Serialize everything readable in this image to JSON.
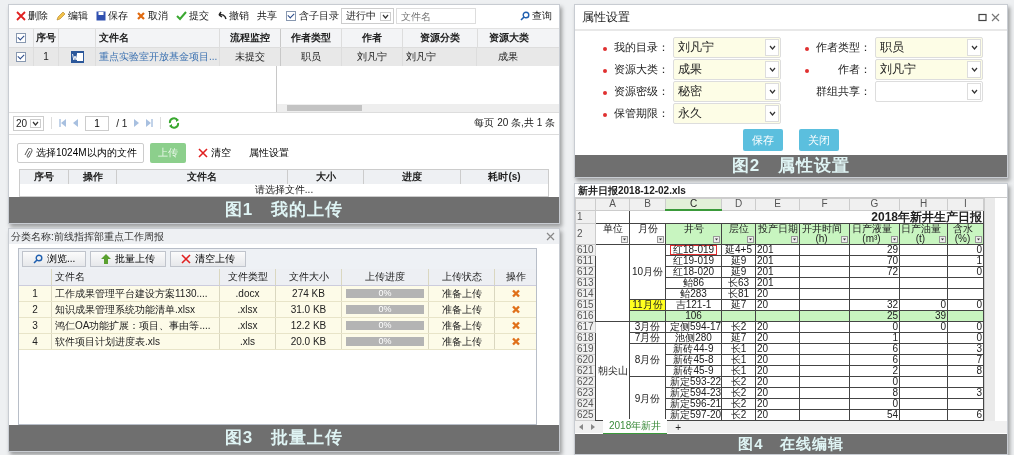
{
  "upload_panel": {
    "toolbar": [
      {
        "kind": "delete",
        "label": "删除"
      },
      {
        "kind": "edit",
        "label": "编辑"
      },
      {
        "kind": "save",
        "label": "保存"
      },
      {
        "kind": "cancel",
        "label": "取消"
      },
      {
        "kind": "submit",
        "label": "提交"
      },
      {
        "kind": "undo",
        "label": "撤销"
      },
      {
        "kind": "text",
        "label": "共享"
      }
    ],
    "subdir": {
      "label": "含子目录",
      "checked": true
    },
    "status_select": "进行中",
    "search": {
      "placeholder": "文件名",
      "button": "查询"
    },
    "columns": [
      "序号",
      "文件名",
      "流程监控",
      "作者类型",
      "作者",
      "资源分类",
      "资源大类"
    ],
    "all_checked": true,
    "rows": [
      {
        "checked": true,
        "number": "1",
        "name": "重点实验室开放基金项目...",
        "flow": "未提交",
        "author_type": "职员",
        "author": "刘凡宁",
        "category": "刘凡宁",
        "major": "成果"
      }
    ],
    "pager": {
      "page_size": "20",
      "page": "1",
      "total_pages": "/ 1",
      "summary": "每页 20 条,共 1 条"
    },
    "upload_actions": {
      "choose": "选择1024M以内的文件",
      "upload": "上传",
      "upload_disabled": true,
      "clear": "清空",
      "settings": "属性设置"
    },
    "queue_columns": [
      "序号",
      "操作",
      "文件名",
      "大小",
      "进度",
      "耗时(s)"
    ],
    "queue_empty": "请选择文件...",
    "caption": "图1　我的上传"
  },
  "settings_panel": {
    "title": "属性设置",
    "left_fields": [
      {
        "label": "我的目录：",
        "value": "刘凡宁",
        "required": true
      },
      {
        "label": "资源大类：",
        "value": "成果",
        "required": true
      },
      {
        "label": "资源密级：",
        "value": "秘密",
        "required": true
      },
      {
        "label": "保管期限：",
        "value": "永久",
        "required": true
      }
    ],
    "right_fields": [
      {
        "label": "作者类型：",
        "value": "职员",
        "required": true
      },
      {
        "label": "作者：",
        "value": "刘凡宁",
        "required": true
      },
      {
        "label": "群组共享：",
        "required": false
      }
    ],
    "buttons": [
      "保存",
      "关闭"
    ],
    "caption": "图2　属性设置"
  },
  "batch_panel": {
    "title": "分类名称:前线指挥部重点工作周报",
    "toolbar": [
      {
        "kind": "browse",
        "label": "浏览..."
      },
      {
        "kind": "upload",
        "label": "批量上传"
      },
      {
        "kind": "clear",
        "label": "清空上传"
      }
    ],
    "columns": [
      "文件名",
      "文件类型",
      "文件大小",
      "上传进度",
      "上传状态",
      "操作"
    ],
    "rows": [
      {
        "number": "1",
        "name": "工作成果管理平台建设方案1130....",
        "type": ".docx",
        "size": "274 KB",
        "level": 0,
        "progress": "0%",
        "status": "准备上传"
      },
      {
        "number": "2",
        "name": "知识成果管理系统功能清单.xlsx",
        "type": ".xlsx",
        "size": "31.0 KB",
        "level": 0,
        "progress": "0%",
        "status": "准备上传"
      },
      {
        "number": "3",
        "name": "鸿仁OA功能扩展：项目、事由等....",
        "type": ".xlsx",
        "size": "12.2 KB",
        "level": 0,
        "progress": "0%",
        "status": "准备上传"
      },
      {
        "number": "4",
        "name": "软件项目计划进度表.xls",
        "type": ".xls",
        "size": "20.0 KB",
        "level": 0,
        "progress": "0%",
        "status": "准备上传"
      }
    ],
    "caption": "图3　批量上传"
  },
  "sheet_panel": {
    "title": "新井日报2018-12-02.xls",
    "columns": [
      {
        "letter": "A",
        "selected": false
      },
      {
        "letter": "B",
        "selected": false
      },
      {
        "letter": "C",
        "selected": true
      },
      {
        "letter": "D",
        "selected": false
      },
      {
        "letter": "E",
        "selected": false
      },
      {
        "letter": "F",
        "selected": false
      },
      {
        "letter": "G",
        "selected": false
      },
      {
        "letter": "H",
        "selected": false
      },
      {
        "letter": "I",
        "selected": false
      }
    ],
    "title_row": {
      "number": "1",
      "title": "2018年新井生产日报"
    },
    "header_row": {
      "number": "2",
      "headers": [
        {
          "label": "单位"
        },
        {
          "label": "月份"
        },
        {
          "label": "井号"
        },
        {
          "label": "层位"
        },
        {
          "label": "投产日期"
        },
        {
          "label": "开井时间",
          "unit": "(h)"
        },
        {
          "label": "日产液量",
          "unit": "(m³)"
        },
        {
          "label": "日产油量",
          "unit": "(t)"
        },
        {
          "label": "含水",
          "unit": "(%)"
        }
      ]
    },
    "units": [
      {
        "months": [
          {
            "label": "10月份",
            "highlight": false,
            "rows": [
              {
                "kind": "data",
                "selected": true,
                "number": "610",
                "well": "红18-019",
                "layer": "延4+5",
                "date": "201",
                "liquid": "29",
                "water": "0"
              },
              {
                "kind": "data",
                "selected": false,
                "number": "611",
                "well": "红19-019",
                "layer": "延9",
                "date": "201",
                "liquid": "70",
                "water": "1"
              },
              {
                "kind": "data",
                "selected": false,
                "number": "612",
                "well": "红18-020",
                "layer": "延9",
                "date": "201",
                "liquid": "72",
                "water": "0"
              },
              {
                "kind": "data",
                "selected": false,
                "number": "613",
                "well": "鲐86",
                "layer": "长63",
                "date": "201"
              },
              {
                "kind": "data",
                "selected": false,
                "number": "614",
                "well": "鲐283",
                "layer": "长81",
                "date": "20"
              }
            ]
          },
          {
            "label": "11月份",
            "highlight": true,
            "rows": [
              {
                "kind": "data",
                "selected": false,
                "number": "615",
                "well": "吉121-1",
                "layer": "延7",
                "date": "20",
                "liquid": "32",
                "oil": "0",
                "water": "0"
              }
            ]
          },
          {
            "highlight": false,
            "rows": [
              {
                "kind": "total",
                "selected": false,
                "number": "616",
                "well": "106",
                "liquid": "25",
                "oil": "39"
              }
            ]
          }
        ]
      },
      {
        "label": "朝尖山",
        "months": [
          {
            "label": "3月份",
            "highlight": false,
            "rows": [
              {
                "kind": "data",
                "selected": false,
                "number": "617",
                "well": "定侧594-17",
                "layer": "长2",
                "date": "20",
                "liquid": "0",
                "oil": "0",
                "water": "0"
              }
            ]
          },
          {
            "label": "7月份",
            "highlight": false,
            "rows": [
              {
                "kind": "data",
                "selected": false,
                "number": "618",
                "well": "池侧280",
                "layer": "延7",
                "date": "20",
                "liquid": "1",
                "water": "0"
              }
            ]
          },
          {
            "label": "8月份",
            "highlight": false,
            "rows": [
              {
                "kind": "data",
                "selected": false,
                "number": "619",
                "well": "新砖44-9",
                "layer": "长1",
                "date": "20",
                "liquid": "6",
                "water": "3"
              },
              {
                "kind": "data",
                "selected": false,
                "number": "620",
                "well": "新砖45-8",
                "layer": "长1",
                "date": "20",
                "liquid": "6",
                "water": "7"
              },
              {
                "kind": "data",
                "selected": false,
                "number": "621",
                "well": "新砖45-9",
                "layer": "长1",
                "date": "20",
                "liquid": "2",
                "water": "8"
              }
            ]
          },
          {
            "label": "9月份",
            "highlight": false,
            "rows": [
              {
                "kind": "data",
                "selected": false,
                "number": "622",
                "well": "新定593-22",
                "layer": "长2",
                "date": "20",
                "liquid": "0"
              },
              {
                "kind": "data",
                "selected": false,
                "number": "623",
                "well": "新定594-23",
                "layer": "长2",
                "date": "20",
                "liquid": "8",
                "water": "3"
              },
              {
                "kind": "data",
                "selected": false,
                "number": "624",
                "well": "新定596-21",
                "layer": "长2",
                "date": "20",
                "liquid": "0"
              },
              {
                "kind": "data",
                "selected": false,
                "number": "625",
                "well": "新定597-20",
                "layer": "长2",
                "date": "20",
                "liquid": "54",
                "water": "6"
              }
            ]
          }
        ]
      }
    ],
    "sheet_tabs": [
      {
        "label": "2018年新井",
        "selected": true
      }
    ],
    "add_tab": "+",
    "caption": "图4　在线编辑"
  }
}
